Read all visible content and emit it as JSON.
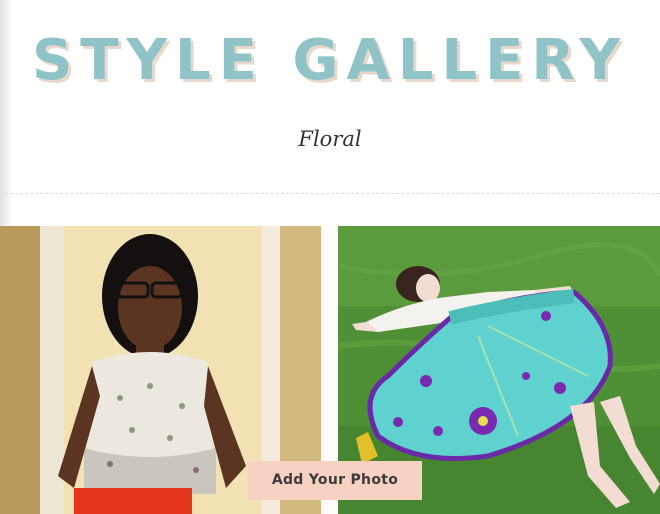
{
  "header": {
    "title": "STYLE GALLERY",
    "subtitle": "Floral"
  },
  "gallery": {
    "photos": [
      {
        "subject": "woman in floral sleeveless top with red skirt"
      },
      {
        "subject": "woman lying on grass in turquoise circle skirt with purple flowers"
      }
    ],
    "add_button_label": "Add Your Photo"
  },
  "colors": {
    "title": "#8fc3c7",
    "title_shadow": "#e7d8cb",
    "divider": "#efd7c6",
    "button_bg": "#f7d1c2"
  }
}
